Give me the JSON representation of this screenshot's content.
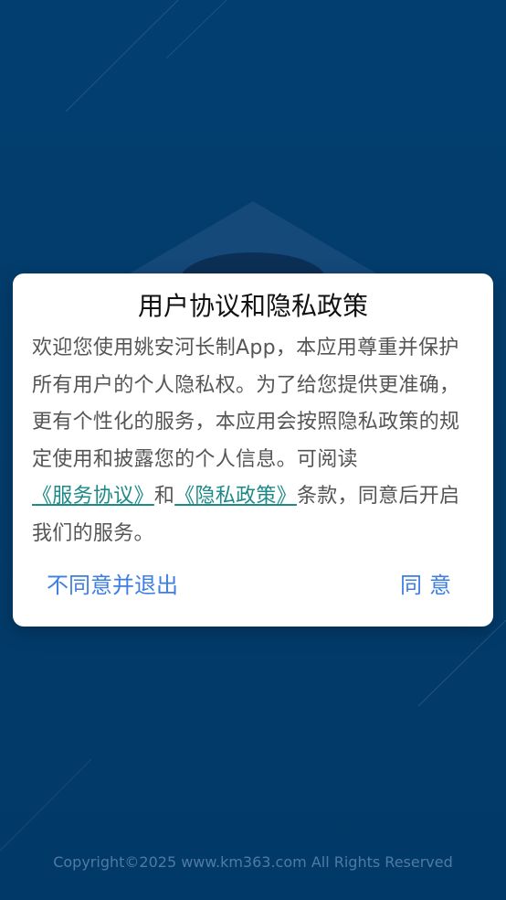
{
  "dialog": {
    "title": "用户协议和隐私政策",
    "body_intro": "  欢迎您使用姚安河长制App，本应用尊重并保护所有用户的个人隐私权。为了给您提供更准确，更有个性化的服务，本应用会按照隐私政策的规定使用和披露您的个人信息。可阅读",
    "link_service": "《服务协议》",
    "connector": "和",
    "link_privacy": "《隐私政策》",
    "body_outro": "条款，同意后开启我们的服务。",
    "disagree_label": "不同意并退出",
    "agree_label": "同意"
  },
  "footer": {
    "copyright": "Copyright©2025 www.km363.com All Rights Reserved"
  },
  "colors": {
    "background": "#023d6e",
    "link": "#1d8a87",
    "button": "#3d7ee0"
  }
}
